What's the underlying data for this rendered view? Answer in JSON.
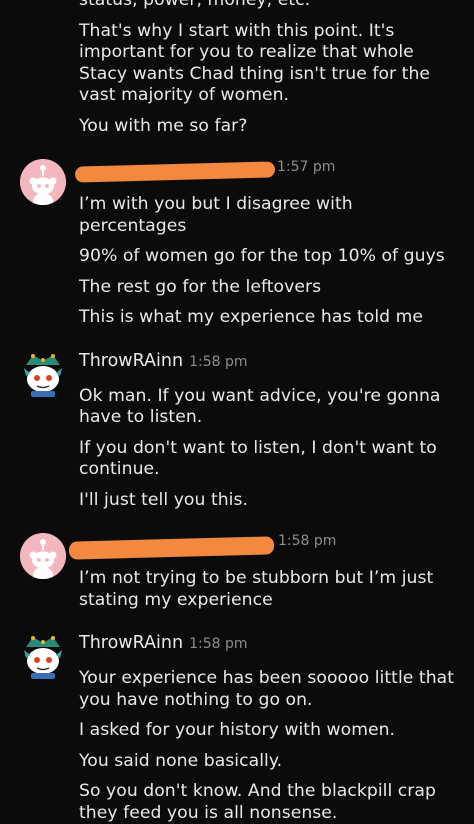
{
  "messages": [
    {
      "author_visible": "",
      "time": "",
      "lines": [
        "status, power, money, etc.",
        "That's why I start with this point. It's important for you to realize that whole Stacy wants Chad thing isn't true for the vast majority of women.",
        "You with me so far?"
      ]
    },
    {
      "author_visible": "",
      "time": "1:57 pm",
      "lines": [
        "I’m with you but I disagree with percentages",
        "90% of women go for the top 10% of guys",
        "The rest go for the leftovers",
        "This is what my experience has told me"
      ]
    },
    {
      "author_visible": "ThrowRAinn",
      "time": "1:58 pm",
      "lines": [
        "Ok man. If you want advice, you're gonna have to listen.",
        "If you don't want to listen, I don't want to continue.",
        "I'll just tell you this."
      ]
    },
    {
      "author_visible": "",
      "time": "1:58 pm",
      "lines": [
        "I’m not trying to be stubborn but I’m just stating my experience"
      ]
    },
    {
      "author_visible": "ThrowRAinn",
      "time": "1:58 pm",
      "lines": [
        "Your experience has been sooooo little that you have nothing to go on.",
        "I asked for your history with women.",
        "You said none basically.",
        "So you don't know. And the blackpill crap they feed you is all nonsense."
      ]
    }
  ],
  "colors": {
    "background": "#0b0b0b",
    "text": "#e9e9ea",
    "timestamp": "#8d8d90",
    "redaction": "#f3883f",
    "default_avatar": "#f4b7c0"
  },
  "icons": {
    "user_avatar": "reddit-default-snoo-avatar",
    "throwrainn_avatar": "snoo-avatar-with-crown"
  }
}
